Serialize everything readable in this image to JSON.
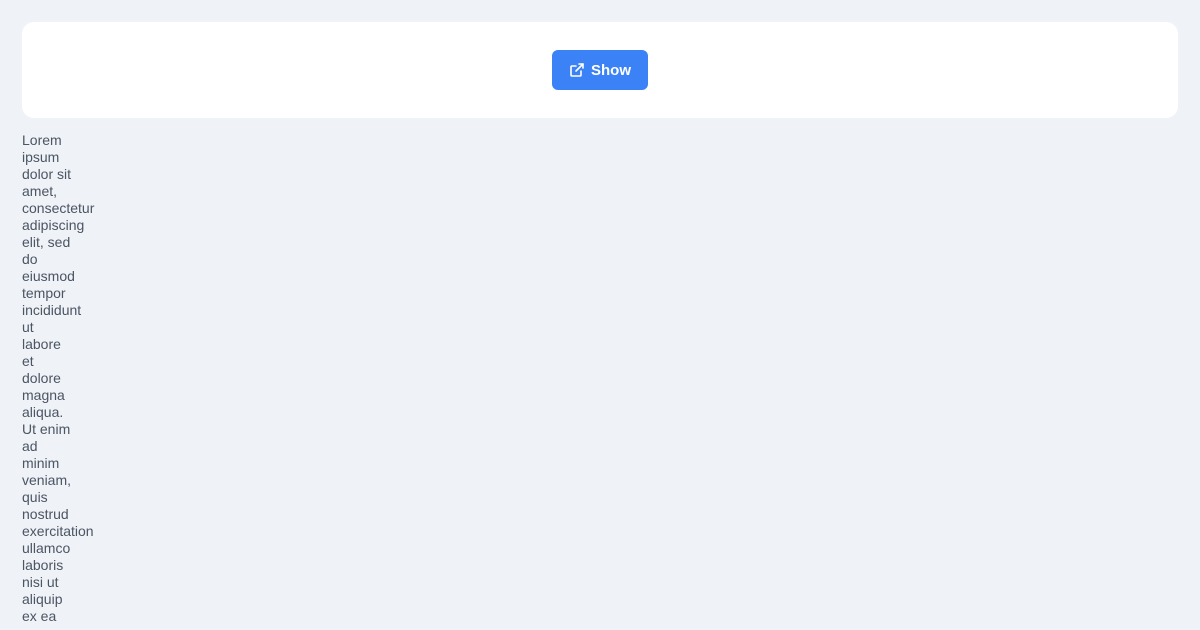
{
  "toolbar": {
    "show_label": "Show",
    "button_color": "#3b82f6",
    "button_icon": "external-link-icon"
  },
  "content": {
    "text": "Lorem\nipsum\ndolor sit\namet,\nconsectetur\nadipiscing\nelit, sed\ndo\neiusmod\ntempor\nincididunt\nut\nlabore\net\ndolore\nmagna\naliqua.\nUt enim\nad\nminim\nveniam,\nquis\nnostrud\nexercitation\nullamco\nlaboris\nnisi ut\naliquip\nex ea"
  }
}
